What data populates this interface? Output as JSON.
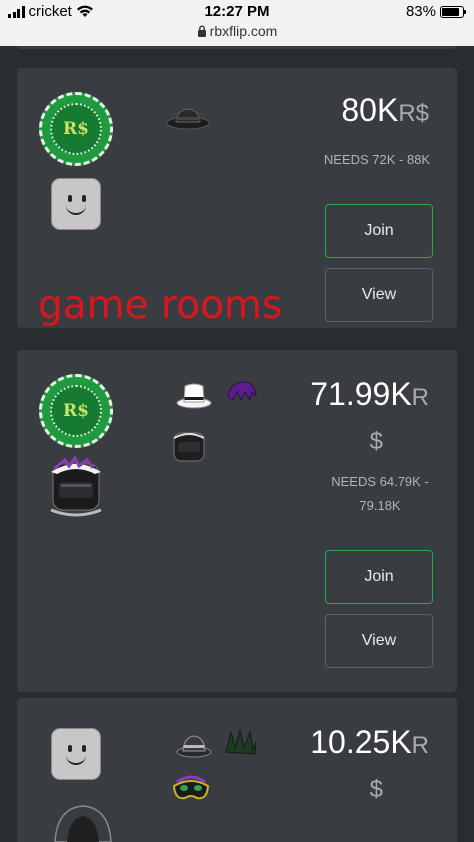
{
  "status_bar": {
    "carrier": "cricket",
    "time": "12:27 PM",
    "url": "rbxflip.com",
    "battery": "83%",
    "battery_fraction": 0.83
  },
  "overlay_text": "game rooms",
  "rooms": [
    {
      "currency_badge": "R$",
      "price_value": "80K",
      "price_currency": "R$",
      "needs": "NEEDS 72K - 88K",
      "join_label": "Join",
      "view_label": "View",
      "items": [
        "dark-fedora-icon"
      ]
    },
    {
      "currency_badge": "R$",
      "price_value": "71.99K",
      "price_currency": "R",
      "price_currency_2": "$",
      "needs_line1": "NEEDS 64.79K -",
      "needs_line2": "79.18K",
      "join_label": "Join",
      "view_label": "View",
      "items": [
        "white-top-hat-icon",
        "purple-hair-icon",
        "masked-face-icon"
      ]
    },
    {
      "price_value": "10.25K",
      "price_currency": "R",
      "price_currency_2": "$",
      "items": [
        "fedora-icon",
        "green-hair-icon",
        "masquerade-mask-icon"
      ]
    }
  ]
}
